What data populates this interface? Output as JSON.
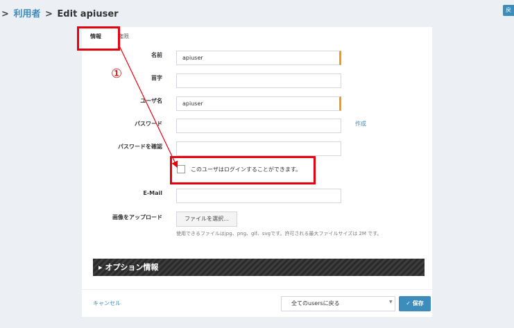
{
  "breadcrumb": {
    "part1": "利用者",
    "sep": "›",
    "current": "Edit apiuser"
  },
  "header": {
    "back_label": "戻"
  },
  "tabs": [
    {
      "label": "情報"
    },
    {
      "label": "権限"
    }
  ],
  "form": {
    "name": {
      "label": "名前",
      "value": "apiuser"
    },
    "surname": {
      "label": "苗字",
      "value": ""
    },
    "username": {
      "label": "ユーザ名",
      "value": "apiuser"
    },
    "password": {
      "label": "パスワード",
      "value": "",
      "create_link": "作成"
    },
    "password_confirm": {
      "label": "パスワードを確認",
      "value": ""
    },
    "login_checkbox": {
      "label": "このユーザはログインすることができます。",
      "checked": false
    },
    "email": {
      "label": "E-Mail",
      "value": ""
    },
    "upload": {
      "label": "画像をアップロード",
      "button": "ファイルを選択...",
      "help": "使用できるファイルはjpg、png、gif、svgです。許可される最大ファイルサイズは 2M です。"
    }
  },
  "options": {
    "label": "オプション情報"
  },
  "footer": {
    "cancel": "キャンセル",
    "redirect_select": "全てのusersに戻る",
    "save": "保存"
  },
  "annotation": {
    "marker": "①"
  },
  "colors": {
    "accent": "#3c8dbc",
    "required": "#f39c12",
    "highlight": "#e8000d"
  }
}
